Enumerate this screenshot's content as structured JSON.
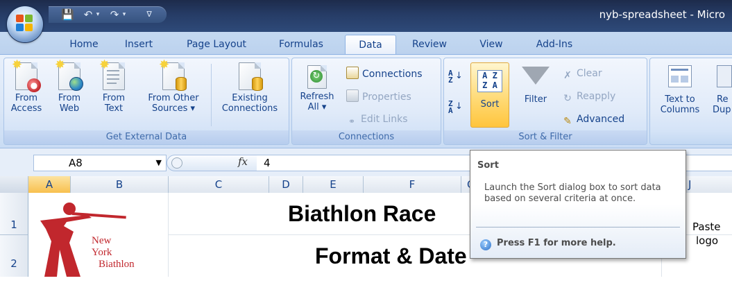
{
  "window": {
    "title": "nyb-spreadsheet - Micro"
  },
  "quick_access": {
    "icons": [
      "save-icon",
      "undo-icon",
      "redo-icon",
      "customize-qat-icon"
    ]
  },
  "tabs": [
    {
      "label": "Home"
    },
    {
      "label": "Insert"
    },
    {
      "label": "Page Layout"
    },
    {
      "label": "Formulas"
    },
    {
      "label": "Data",
      "active": true
    },
    {
      "label": "Review"
    },
    {
      "label": "View"
    },
    {
      "label": "Add-Ins"
    }
  ],
  "ribbon": {
    "get_external": {
      "label": "Get External Data",
      "from_access": [
        "From",
        "Access"
      ],
      "from_web": [
        "From",
        "Web"
      ],
      "from_text": [
        "From",
        "Text"
      ],
      "from_other": [
        "From Other",
        "Sources ▾"
      ],
      "existing": [
        "Existing",
        "Connections"
      ]
    },
    "connections": {
      "label": "Connections",
      "refresh": [
        "Refresh",
        "All ▾"
      ],
      "connections": "Connections",
      "properties": "Properties",
      "edit_links": "Edit Links"
    },
    "sort_filter": {
      "label": "Sort & Filter",
      "sort": "Sort",
      "filter": "Filter",
      "clear": "Clear",
      "reapply": "Reapply",
      "advanced": "Advanced"
    },
    "data_tools": {
      "text_to_columns": [
        "Text to",
        "Columns"
      ],
      "remove_dup": [
        "Re",
        "Dup"
      ]
    }
  },
  "formula_bar": {
    "name_box": "A8",
    "fx": "fx",
    "value": "4"
  },
  "grid": {
    "columns": [
      "A",
      "B",
      "C",
      "D",
      "E",
      "F",
      "G",
      "J"
    ],
    "rows": [
      "1",
      "2"
    ],
    "title_line1": "Biathlon Race",
    "title_line2": "Format & Date",
    "paste_logo": [
      "Paste",
      "logo"
    ],
    "logo_text": [
      "New",
      "York",
      "Biathlon"
    ]
  },
  "tooltip": {
    "title": "Sort",
    "body": "Launch the Sort dialog box to sort data based on several criteria at once.",
    "help": "Press F1 for more help."
  }
}
